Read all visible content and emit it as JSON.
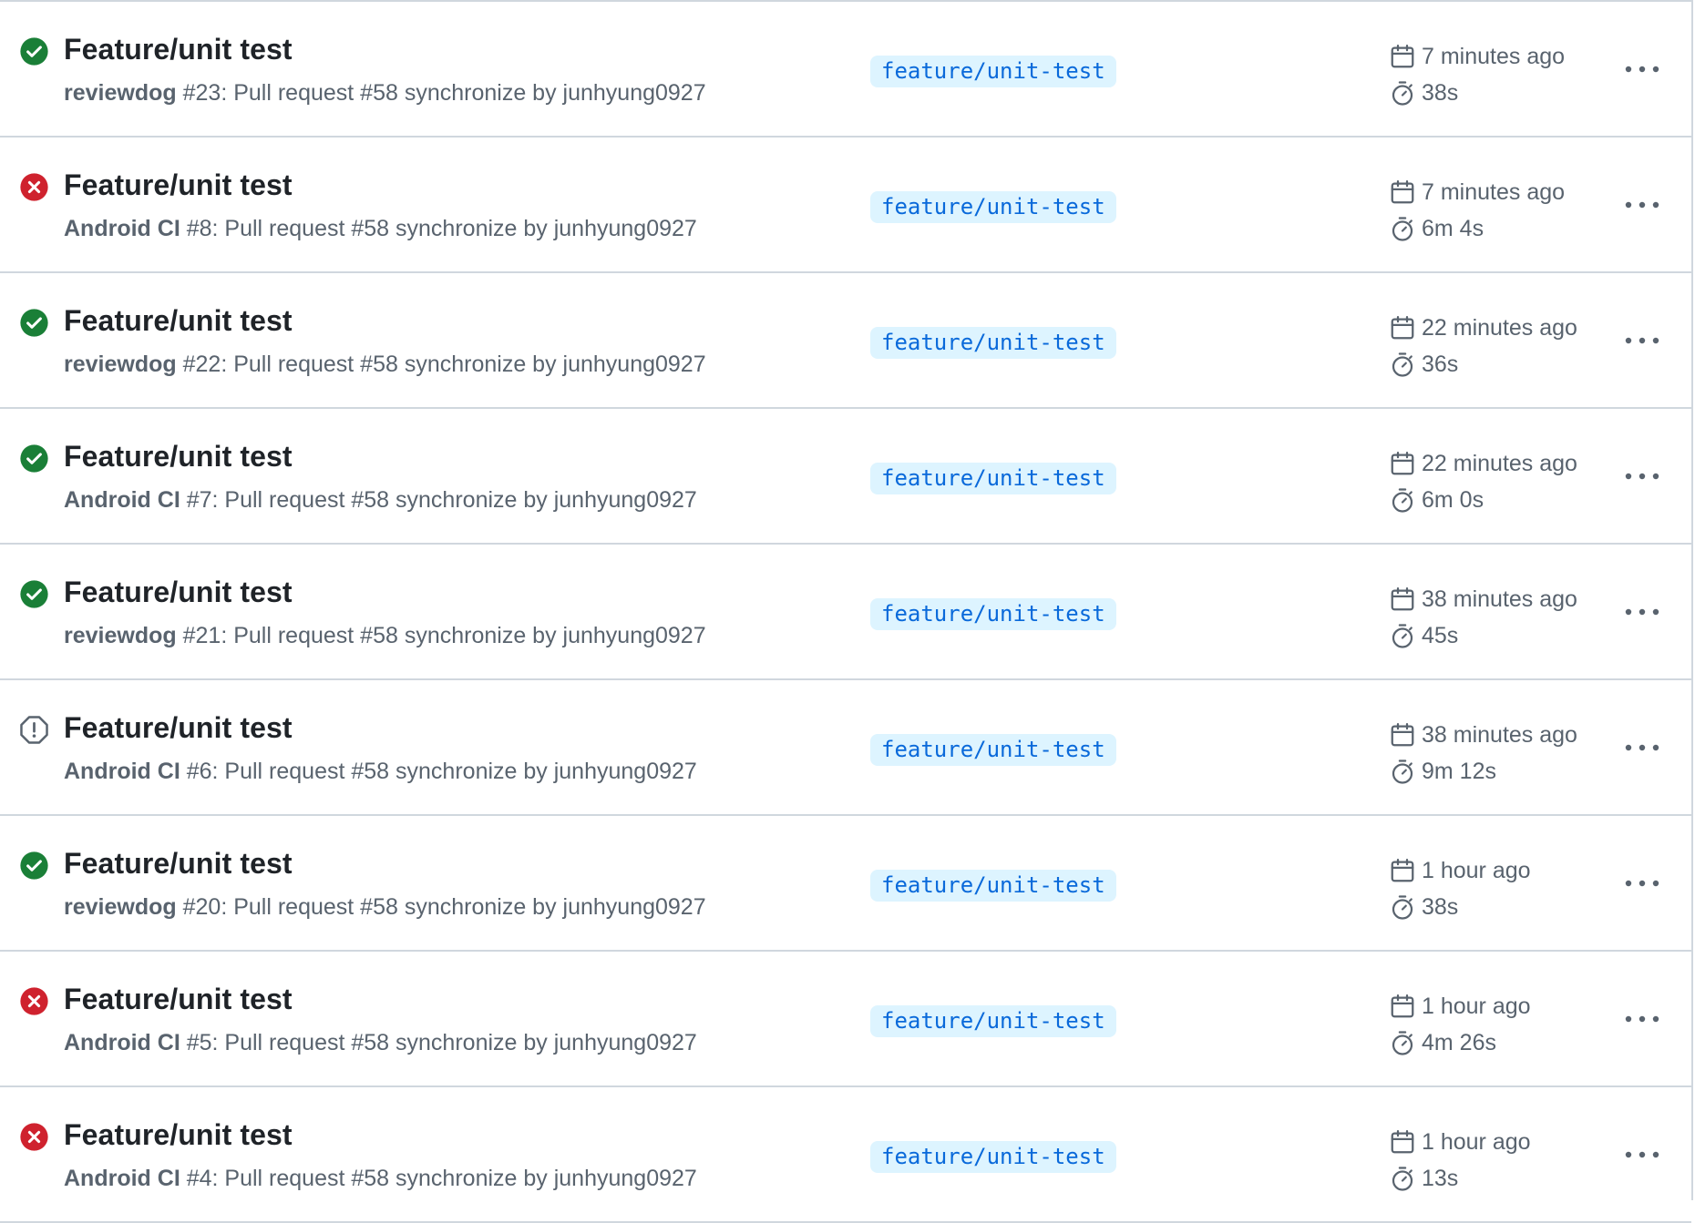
{
  "colors": {
    "success": "#1a7f37",
    "failure": "#cf222e",
    "neutral": "#59636e",
    "branch_bg": "#ddf4ff",
    "branch_text": "#0969da"
  },
  "runs": [
    {
      "status": "success",
      "status_icon": "check-circle-fill-icon",
      "title": "Feature/unit test",
      "workflow": "reviewdog",
      "details": " #23: Pull request #58 synchronize by junhyung0927",
      "branch": "feature/unit-test",
      "date": "7 minutes ago",
      "duration": "38s"
    },
    {
      "status": "failure",
      "status_icon": "x-circle-fill-icon",
      "title": "Feature/unit test",
      "workflow": "Android CI",
      "details": " #8: Pull request #58 synchronize by junhyung0927",
      "branch": "feature/unit-test",
      "date": "7 minutes ago",
      "duration": "6m 4s"
    },
    {
      "status": "success",
      "status_icon": "check-circle-fill-icon",
      "title": "Feature/unit test",
      "workflow": "reviewdog",
      "details": " #22: Pull request #58 synchronize by junhyung0927",
      "branch": "feature/unit-test",
      "date": "22 minutes ago",
      "duration": "36s"
    },
    {
      "status": "success",
      "status_icon": "check-circle-fill-icon",
      "title": "Feature/unit test",
      "workflow": "Android CI",
      "details": " #7: Pull request #58 synchronize by junhyung0927",
      "branch": "feature/unit-test",
      "date": "22 minutes ago",
      "duration": "6m 0s"
    },
    {
      "status": "success",
      "status_icon": "check-circle-fill-icon",
      "title": "Feature/unit test",
      "workflow": "reviewdog",
      "details": " #21: Pull request #58 synchronize by junhyung0927",
      "branch": "feature/unit-test",
      "date": "38 minutes ago",
      "duration": "45s"
    },
    {
      "status": "cancelled",
      "status_icon": "stop-icon",
      "title": "Feature/unit test",
      "workflow": "Android CI",
      "details": " #6: Pull request #58 synchronize by junhyung0927",
      "branch": "feature/unit-test",
      "date": "38 minutes ago",
      "duration": "9m 12s"
    },
    {
      "status": "success",
      "status_icon": "check-circle-fill-icon",
      "title": "Feature/unit test",
      "workflow": "reviewdog",
      "details": " #20: Pull request #58 synchronize by junhyung0927",
      "branch": "feature/unit-test",
      "date": "1 hour ago",
      "duration": "38s"
    },
    {
      "status": "failure",
      "status_icon": "x-circle-fill-icon",
      "title": "Feature/unit test",
      "workflow": "Android CI",
      "details": " #5: Pull request #58 synchronize by junhyung0927",
      "branch": "feature/unit-test",
      "date": "1 hour ago",
      "duration": "4m 26s"
    },
    {
      "status": "failure",
      "status_icon": "x-circle-fill-icon",
      "title": "Feature/unit test",
      "workflow": "Android CI",
      "details": " #4: Pull request #58 synchronize by junhyung0927",
      "branch": "feature/unit-test",
      "date": "1 hour ago",
      "duration": "13s"
    }
  ]
}
